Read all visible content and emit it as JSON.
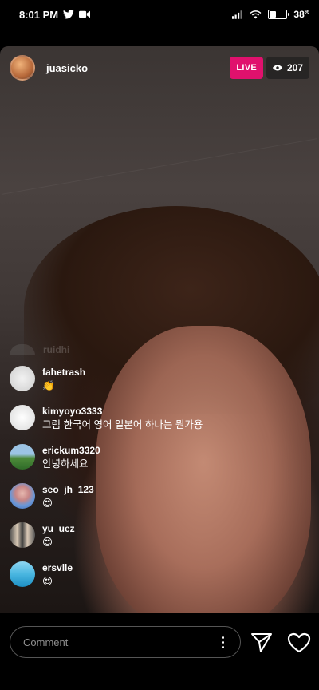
{
  "status_bar": {
    "time": "8:01 PM",
    "battery_percent": "38",
    "battery_level": 0.38,
    "icons": [
      "twitter-icon",
      "video-camera-icon",
      "signal-icon",
      "wifi-icon",
      "battery-icon"
    ]
  },
  "header": {
    "username": "juasicko",
    "live_label": "LIVE",
    "viewer_count": "207",
    "live_color": "#e0116d"
  },
  "comments": {
    "faded_name": "ruidhi",
    "items": [
      {
        "username": "fahetrash",
        "message": "👏"
      },
      {
        "username": "kimyoyo3333",
        "message": "그럼 한국어 영어 일본어 하나는 뭔가용"
      },
      {
        "username": "erickum3320",
        "message": "안녕하세요"
      },
      {
        "username": "seo_jh_123",
        "message": "😍"
      },
      {
        "username": "yu_uez",
        "message": "😍"
      },
      {
        "username": "ersvlle",
        "message": "😍"
      }
    ]
  },
  "bottom_bar": {
    "comment_placeholder": "Comment",
    "icons": [
      "more-options-icon",
      "send-icon",
      "heart-icon"
    ]
  }
}
